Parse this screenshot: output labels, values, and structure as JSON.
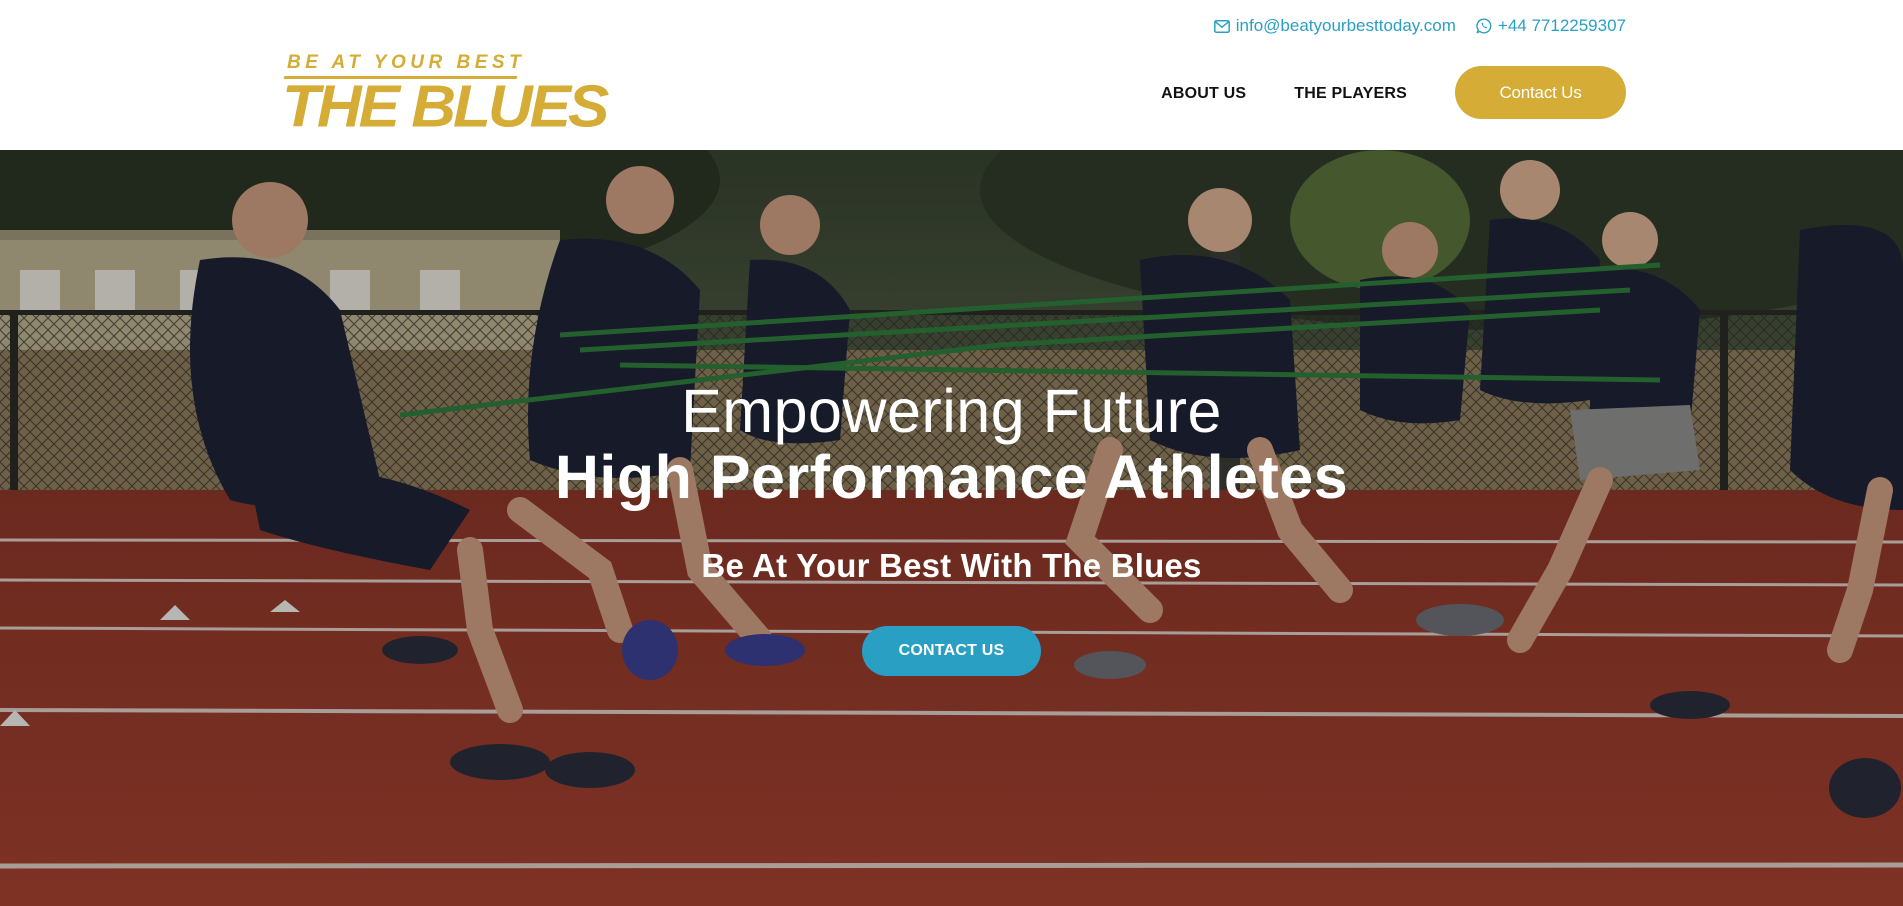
{
  "header": {
    "email": "info@beatyourbesttoday.com",
    "phone": "+44 7712259307",
    "logo": {
      "tagline": "BE AT YOUR BEST",
      "wordmark": "THE BLUES"
    },
    "nav": {
      "about_label": "ABOUT US",
      "players_label": "THE PLAYERS",
      "contact_label": "Contact Us"
    }
  },
  "hero": {
    "line1": "Empowering Future",
    "line2": "High Performance Athletes",
    "subtitle": "Be At Your Best With The Blues",
    "cta_label": "CONTACT US"
  },
  "icons": {
    "email": "envelope-icon",
    "phone": "whatsapp-icon"
  },
  "colors": {
    "brand_gold": "#d4ac36",
    "accent_blue": "#2a9fc4",
    "nav_text": "#111111",
    "hero_text": "#ffffff",
    "track_red": "#9c3a2c"
  }
}
